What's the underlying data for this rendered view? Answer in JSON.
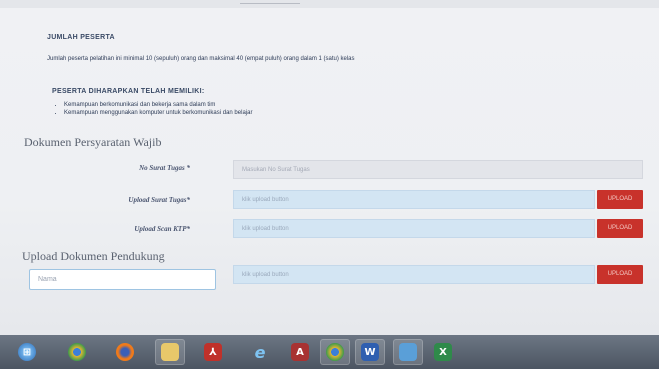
{
  "peserta": {
    "title": "JUMLAH PESERTA",
    "desc": "Jumlah peserta pelatihan ini minimal 10 (sepuluh) orang dan maksimal 40 (empat puluh) orang dalam 1 (satu) kelas"
  },
  "harapan": {
    "title": "PESERTA DIHARAPKAN TELAH MEMILIKI:",
    "items": [
      "Kemampuan berkomunikasi dan bekerja sama dalam tim",
      "Kemampuan menggunakan komputer untuk berkomunikasi dan belajar"
    ]
  },
  "wajib": {
    "heading": "Dokumen Persyaratan Wajib",
    "no_surat": {
      "label": "No Surat Tugas *",
      "placeholder": "Masukan No Surat Tugas"
    },
    "surat_tugas": {
      "label": "Upload Surat Tugas*",
      "file_text": "klik upload button",
      "button": "UPLOAD"
    },
    "scan_ktp": {
      "label": "Upload Scan KTP*",
      "file_text": "klik upload button",
      "button": "UPLOAD"
    }
  },
  "pendukung": {
    "heading": "Upload Dokumen Pendukung",
    "nama_placeholder": "Nama",
    "file_text": "klik upload button",
    "button": "UPLOAD"
  },
  "taskbar": {
    "icons": [
      "start-orb-icon",
      "chrome-icon",
      "firefox-icon",
      "file-explorer-icon",
      "acrobat-icon",
      "internet-explorer-icon",
      "access-icon",
      "chrome-icon",
      "word-icon",
      "photo-viewer-icon",
      "excel-icon"
    ]
  },
  "colors": {
    "upload_button": "#c8322b",
    "file_field": "#d3e5f3",
    "focus_border": "#9ec4e2"
  }
}
